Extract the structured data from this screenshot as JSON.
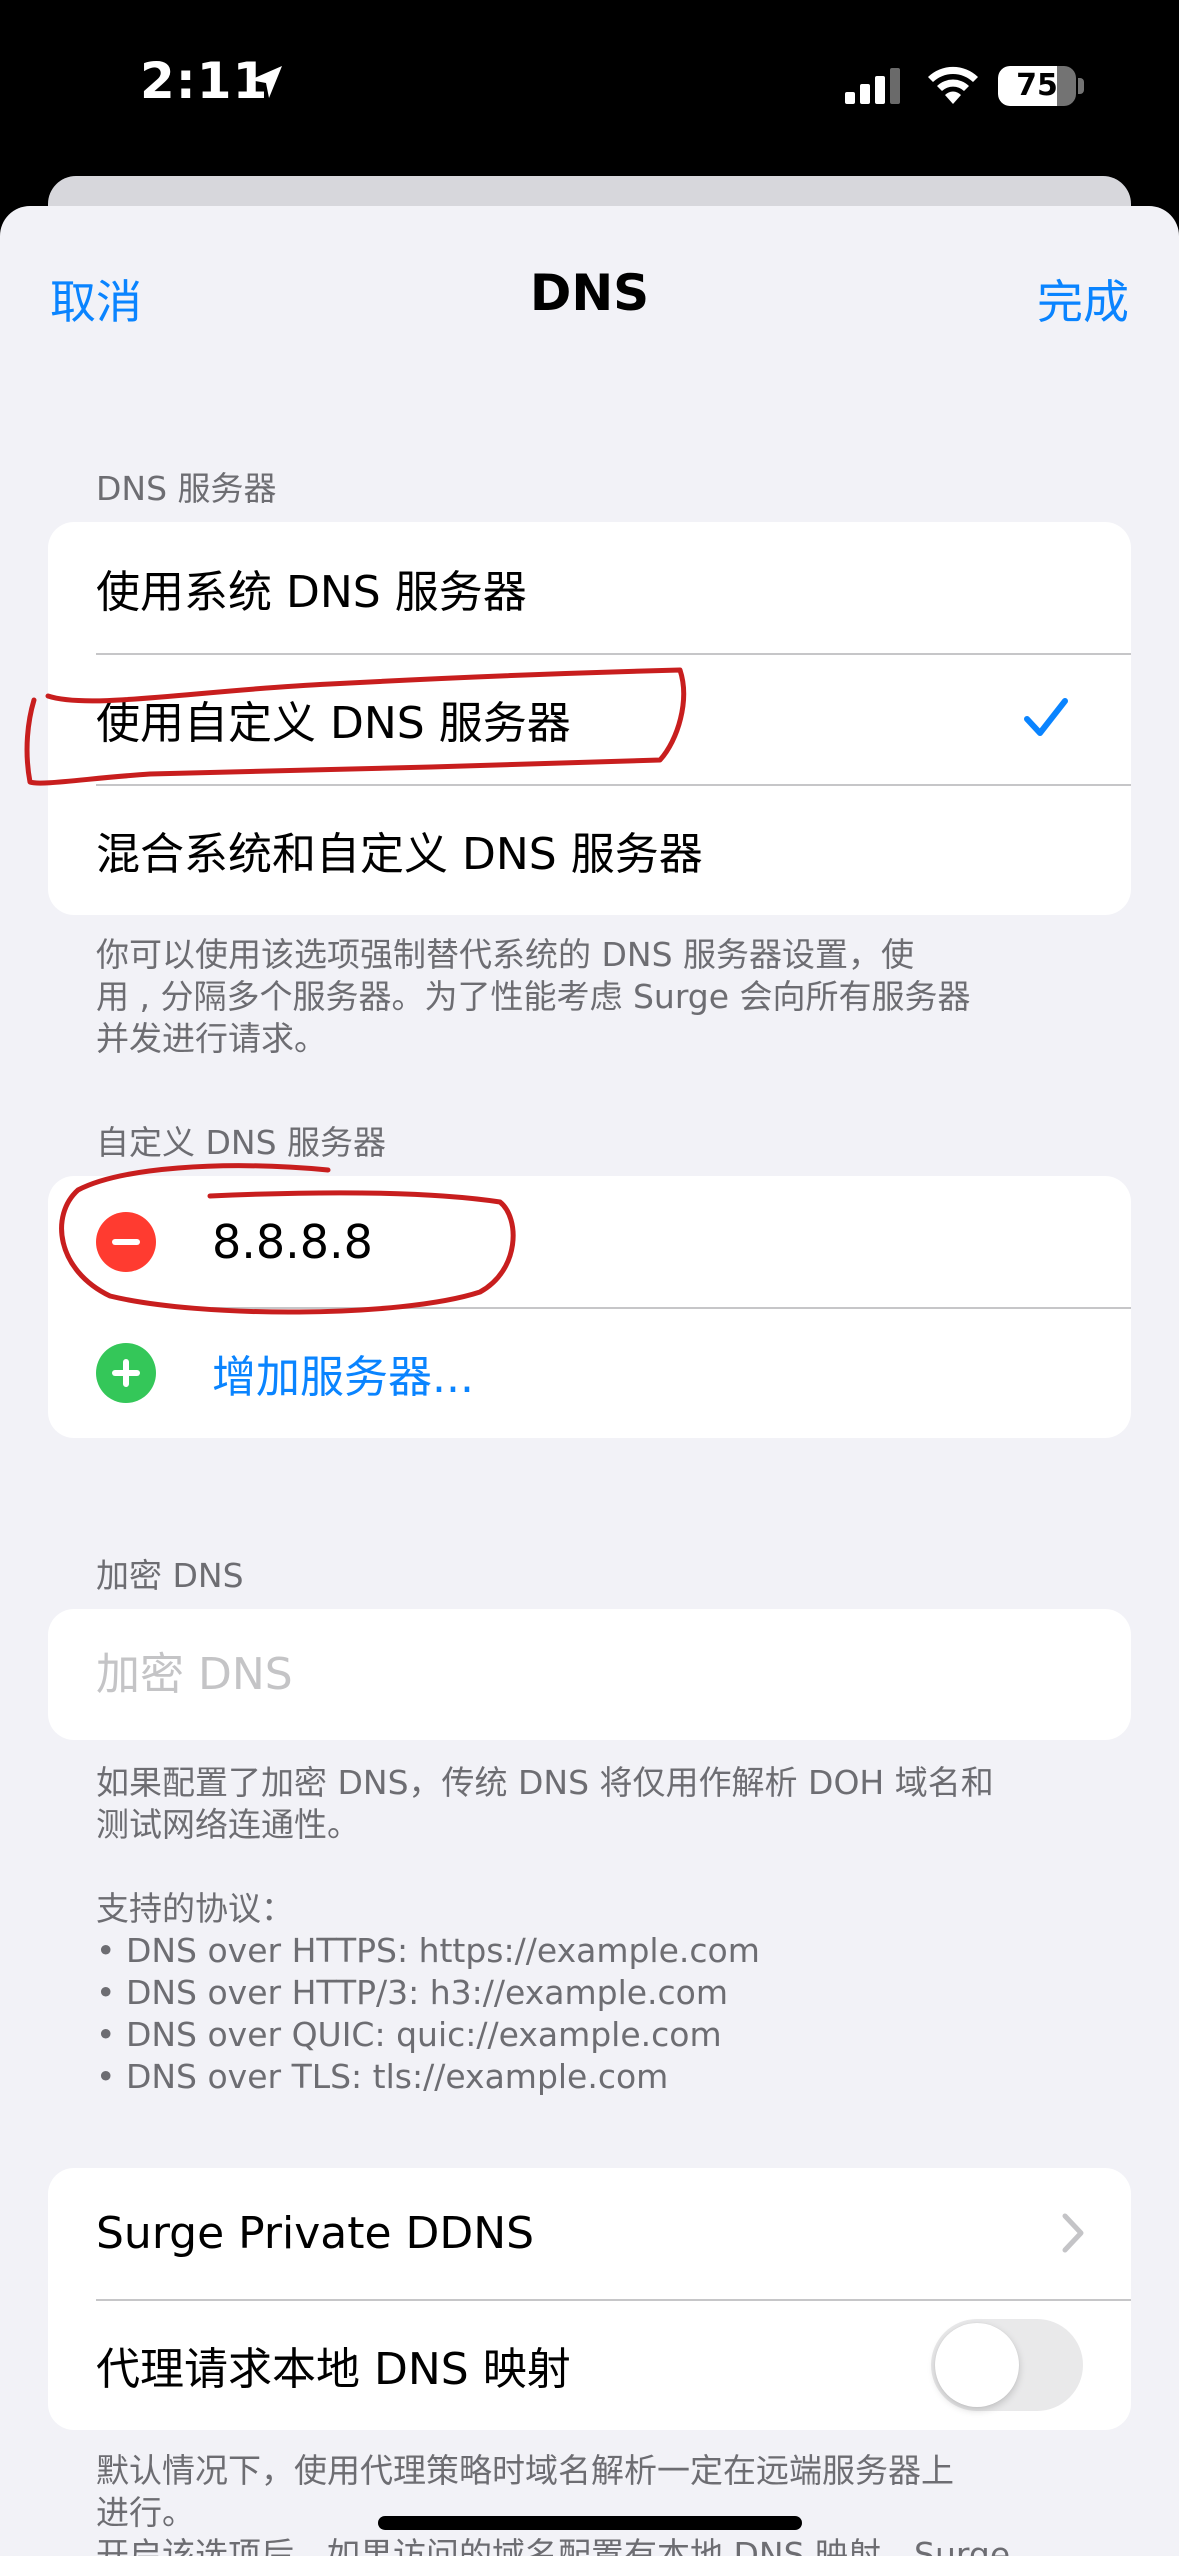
{
  "status_bar": {
    "time": "2:11",
    "battery_percent": 75,
    "battery_label": "75"
  },
  "nav": {
    "cancel_label": "取消",
    "title": "DNS",
    "done_label": "完成"
  },
  "dns_servers": {
    "header": "DNS 服务器",
    "options": [
      {
        "label": "使用系统 DNS 服务器",
        "selected": false
      },
      {
        "label": "使用自定义 DNS 服务器",
        "selected": true
      },
      {
        "label": "混合系统和自定义 DNS 服务器",
        "selected": false
      }
    ],
    "footer": "你可以使用该选项强制替代系统的 DNS 服务器设置，使\n用 , 分隔多个服务器。为了性能考虑 Surge 会向所有服务器\n并发进行请求。"
  },
  "custom_dns": {
    "header": "自定义 DNS 服务器",
    "servers": [
      "8.8.8.8"
    ],
    "add_label": "增加服务器..."
  },
  "encrypted_dns": {
    "header": "加密 DNS",
    "value": "",
    "placeholder": "加密 DNS",
    "footer": "如果配置了加密 DNS，传统 DNS 将仅用作解析 DOH 域名和\n测试网络连通性。\n\n支持的协议：\n• DNS over HTTPS: https://example.com\n• DNS over HTTP/3: h3://example.com\n• DNS over QUIC: quic://example.com\n• DNS over TLS: tls://example.com"
  },
  "more": {
    "ddns_label": "Surge Private DDNS",
    "proxy_local_label": "代理请求本地 DNS 映射",
    "proxy_local_enabled": false,
    "footer": "默认情况下，使用代理策略时域名解析一定在远端服务器上\n进行。\n开启该选项后，如果访问的域名配置有本地 DNS 映射，Surge"
  },
  "colors": {
    "accent": "#0a84ff",
    "destructive": "#ff3b30",
    "add": "#34c759",
    "annotation": "#c81e1e"
  },
  "icons": {
    "location": "location-arrow-icon",
    "signal": "cellular-signal-icon",
    "wifi": "wifi-icon",
    "check": "checkmark-icon",
    "remove": "minus-circle-icon",
    "add": "plus-circle-icon",
    "chevron": "chevron-right-icon"
  }
}
